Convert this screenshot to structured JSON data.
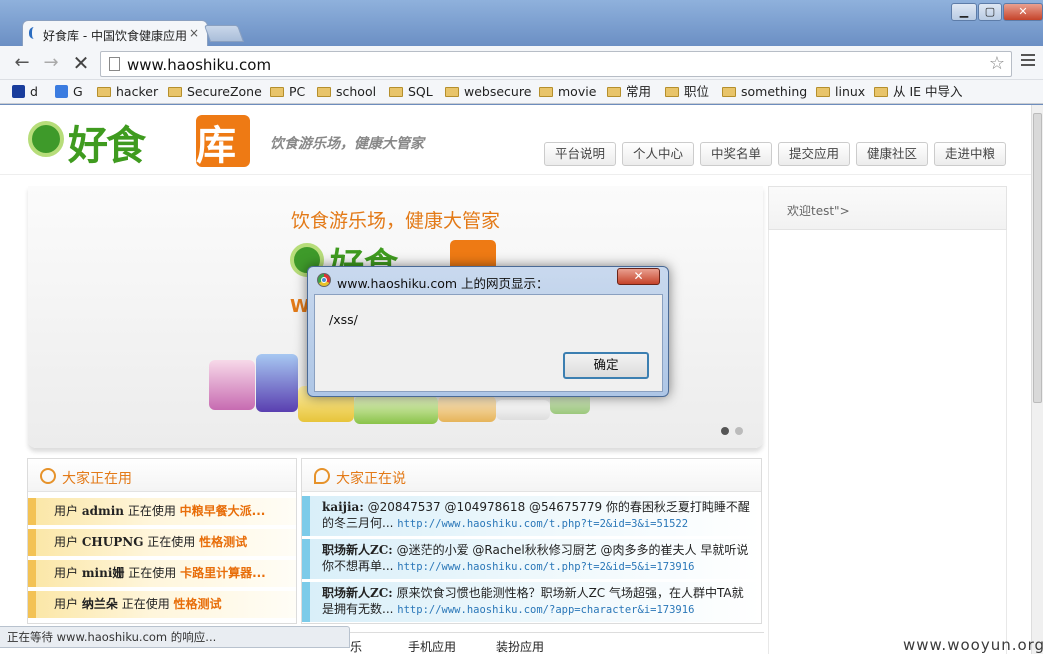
{
  "browser": {
    "tab_title": "好食库 - 中国饮食健康应用",
    "tab_close": "×",
    "url": "www.haoshiku.com",
    "window_buttons": {
      "minimize": "▭",
      "maximize": "□",
      "close": "✕"
    },
    "bookmarks": [
      {
        "label": "d",
        "icon": "paw-icon"
      },
      {
        "label": "G",
        "icon": "google-icon"
      },
      {
        "label": "hacker",
        "icon": "folder-icon"
      },
      {
        "label": "SecureZone",
        "icon": "folder-icon"
      },
      {
        "label": "PC",
        "icon": "folder-icon"
      },
      {
        "label": "school",
        "icon": "folder-icon"
      },
      {
        "label": "SQL",
        "icon": "folder-icon"
      },
      {
        "label": "websecure",
        "icon": "folder-icon"
      },
      {
        "label": "movie",
        "icon": "folder-icon"
      },
      {
        "label": "常用",
        "icon": "folder-icon"
      },
      {
        "label": "职位",
        "icon": "folder-icon"
      },
      {
        "label": "something",
        "icon": "folder-icon"
      },
      {
        "label": "linux",
        "icon": "folder-icon"
      },
      {
        "label": "从 IE 中导入",
        "icon": "folder-icon"
      }
    ],
    "status": "正在等待 www.haoshiku.com 的响应..."
  },
  "site": {
    "logo_text_green": "好食",
    "logo_text_orange": "库",
    "slogan": "饮食游乐场，健康大管家",
    "nav": [
      "平台说明",
      "个人中心",
      "中奖名单",
      "提交应用",
      "健康社区",
      "走进中粮"
    ],
    "banner": {
      "slogan": "饮食游乐场，健康大管家",
      "logo_text": "好食",
      "w_text": "W"
    },
    "welcome": "欢迎test\">",
    "using_panel": {
      "title": "大家正在用",
      "rows": [
        {
          "prefix": "用户",
          "user": "admin",
          "mid": "正在使用",
          "app": "中粮早餐大派..."
        },
        {
          "prefix": "用户",
          "user": "CHUPNG",
          "mid": "正在使用",
          "app": "性格测试"
        },
        {
          "prefix": "用户",
          "user": "mini姗",
          "mid": "正在使用",
          "app": "卡路里计算器..."
        },
        {
          "prefix": "用户",
          "user": "纳兰朵",
          "mid": "正在使用",
          "app": "性格测试"
        }
      ]
    },
    "saying_panel": {
      "title": "大家正在说",
      "rows": [
        {
          "name": "kaijia:",
          "text": "@20847537 @104978618 @54675779 你的春困秋乏夏打盹睡不醒的冬三月何...",
          "link": "http://www.haoshiku.com/t.php?t=2&id=3&i=51522"
        },
        {
          "name": "职场新人ZC:",
          "text": "@迷茫的小爱 @Rachel秋秋修习厨艺 @肉多多的崔夫人 早就听说你不想再单...",
          "link": "http://www.haoshiku.com/t.php?t=2&id=5&i=173916"
        },
        {
          "name": "职场新人ZC:",
          "text": "原来饮食习惯也能测性格？职场新人ZC 气场超强，在人群中TA就是拥有无数...",
          "link": "http://www.haoshiku.com/?app=character&i=173916"
        }
      ]
    },
    "bottom_tabs": [
      "乐",
      "手机应用",
      "装扮应用"
    ]
  },
  "dialog": {
    "title": "www.haoshiku.com 上的网页显示：",
    "message": "/xss/",
    "ok": "确定",
    "close": "✕"
  },
  "watermark": "www.wooyun.org"
}
